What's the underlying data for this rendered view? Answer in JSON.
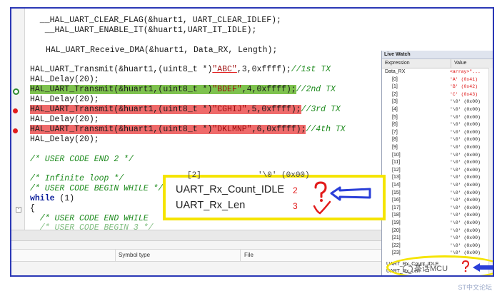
{
  "code": {
    "l1": "  __HAL_UART_CLEAR_FLAG(&huart1, UART_CLEAR_IDLEF);",
    "l2": "   __HAL_UART_ENABLE_IT(&huart1,UART_IT_IDLE);",
    "l3": "HAL_UART_Receive_DMA(&huart1, Data_RX, Length);",
    "l4a": "HAL_UART_Transmit(&huart1,(uint8_t *)",
    "l4s": "\"ABC\"",
    "l4b": ",3,0xffff);",
    "l4c": "//1st TX",
    "l5": "HAL_Delay(20);",
    "l6a": "HAL_UART_Transmit(&huart1,(uint8_t *)",
    "l6s": "\"BDEF\"",
    "l6b": ",4,0xffff);",
    "l6c": "//2nd TX",
    "l7": "HAL_Delay(20);",
    "l8a": "HAL_UART_Transmit(&huart1,(uint8_t *)",
    "l8s": "\"CGHIJ\"",
    "l8b": ",5,0xffff);",
    "l8c": "//3rd TX",
    "l9": "HAL_Delay(20);",
    "l10a": "HAL_UART_Transmit(&huart1,(uint8_t *)",
    "l10s": "\"DKLMNP\"",
    "l10b": ",6,0xffff);",
    "l10c": "//4th TX",
    "l11": "HAL_Delay(20);",
    "l12": "/* USER CODE END 2 */",
    "l13": "/* Infinite loop */",
    "l14": "/* USER CODE BEGIN WHILE */",
    "l15kw": "while",
    "l15": " (1)",
    "l16": "{",
    "l17": "  /* USER CODE END WHILE",
    "l18": "  /* USER CODE BEGIN 3 */"
  },
  "live_watch": {
    "title": "Live Watch",
    "col_expression": "Expression",
    "col_value": "Value",
    "root_expr": "Data_RX",
    "root_value": "<array>\"...",
    "items": [
      {
        "expr": "[0]",
        "value": "'A' (0x41)"
      },
      {
        "expr": "[1]",
        "value": "'B' (0x42)"
      },
      {
        "expr": "[2]",
        "value": "'C' (0x43)"
      },
      {
        "expr": "[3]",
        "value": "'\\0' (0x00)"
      },
      {
        "expr": "[4]",
        "value": "'\\0' (0x00)"
      },
      {
        "expr": "[5]",
        "value": "'\\0' (0x00)"
      },
      {
        "expr": "[6]",
        "value": "'\\0' (0x00)"
      },
      {
        "expr": "[7]",
        "value": "'\\0' (0x00)"
      },
      {
        "expr": "[8]",
        "value": "'\\0' (0x00)"
      },
      {
        "expr": "[9]",
        "value": "'\\0' (0x00)"
      },
      {
        "expr": "[10]",
        "value": "'\\0' (0x00)"
      },
      {
        "expr": "[11]",
        "value": "'\\0' (0x00)"
      },
      {
        "expr": "[12]",
        "value": "'\\0' (0x00)"
      },
      {
        "expr": "[13]",
        "value": "'\\0' (0x00)"
      },
      {
        "expr": "[14]",
        "value": "'\\0' (0x00)"
      },
      {
        "expr": "[15]",
        "value": "'\\0' (0x00)"
      },
      {
        "expr": "[16]",
        "value": "'\\0' (0x00)"
      },
      {
        "expr": "[17]",
        "value": "'\\0' (0x00)"
      },
      {
        "expr": "[18]",
        "value": "'\\0' (0x00)"
      },
      {
        "expr": "[19]",
        "value": "'\\0' (0x00)"
      },
      {
        "expr": "[20]",
        "value": "'\\0' (0x00)"
      },
      {
        "expr": "[21]",
        "value": "'\\0' (0x00)"
      },
      {
        "expr": "[22]",
        "value": "'\\0' (0x00)"
      },
      {
        "expr": "[23]",
        "value": "'\\0' (0x00)"
      }
    ],
    "bottom_1": "UART_Rx_Count_IDLE",
    "bottom_2": "UART_Rx_Len"
  },
  "overlay": {
    "behind": "[2]            '\\0' (0x00)",
    "row1_label": "UART_Rx_Count_IDLE",
    "row1_value": "2",
    "row2_label": "UART_Rx_Len",
    "row2_value": "3"
  },
  "bottom_panel": {
    "col_symbol_type": "Symbol type",
    "col_file": "File"
  },
  "watermark": "茶话MCU",
  "footer": "ST中文论坛",
  "colors": {
    "frame": "#2b38b6",
    "highlight_green": "#7ec24e",
    "highlight_red": "#ef6a6a",
    "annotation_yellow": "#f5e400",
    "arrow_blue": "#2a3fd8"
  }
}
